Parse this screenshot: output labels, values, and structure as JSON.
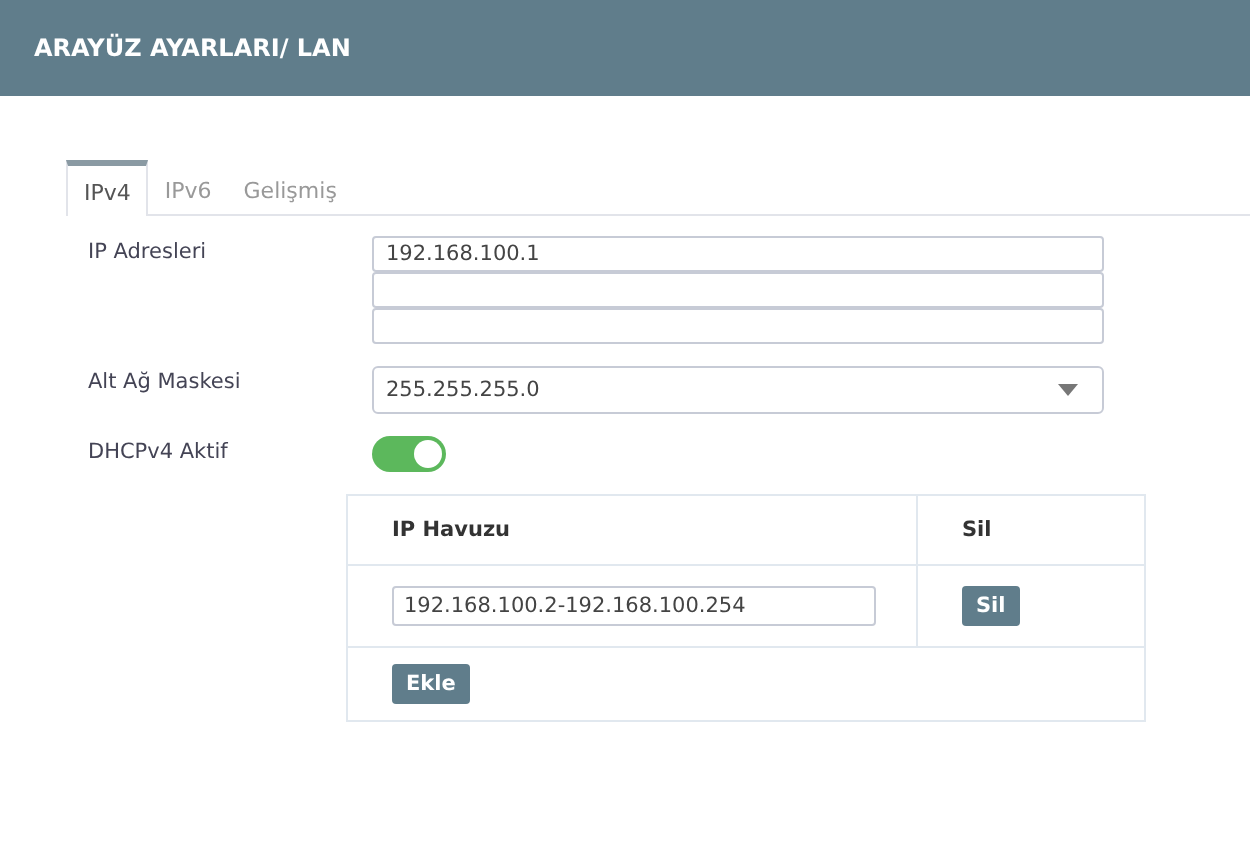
{
  "header": {
    "title": "ARAYÜZ AYARLARI/ LAN"
  },
  "tabs": [
    {
      "label": "IPv4",
      "selected": true
    },
    {
      "label": "IPv6",
      "selected": false
    },
    {
      "label": "Gelişmiş",
      "selected": false
    }
  ],
  "ip_addresses": {
    "label": "IP Adresleri",
    "fields": [
      {
        "kind": "filled",
        "value": "192.168.100.1"
      },
      {
        "kind": "blank"
      },
      {
        "kind": "blank"
      }
    ]
  },
  "subnet_mask": {
    "label": "Alt Ağ Maskesi",
    "value": "255.255.255.0"
  },
  "dhcp": {
    "label": "DHCPv4 Aktif",
    "on": true
  },
  "pool_table": {
    "columns": [
      "IP Havuzu",
      "Sil"
    ],
    "rows": [
      {
        "value": "192.168.100.2-192.168.100.254",
        "button": "Sil"
      }
    ],
    "add_button": "Ekle"
  }
}
